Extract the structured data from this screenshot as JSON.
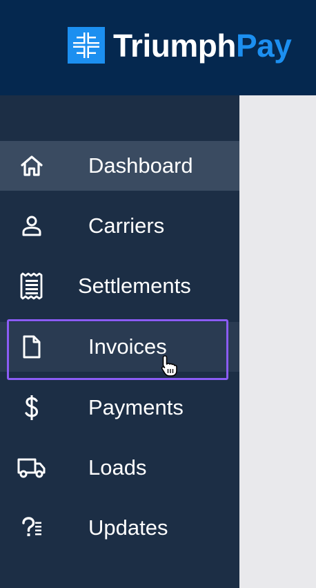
{
  "brand": {
    "name_part1": "Triumph",
    "name_part2": "Pay",
    "accent_color": "#1c8ff0",
    "header_color": "#05284f"
  },
  "sidebar": {
    "background": "#1c2e45",
    "active_item": "Dashboard",
    "hovered_item": "Invoices",
    "items": [
      {
        "label": "Dashboard",
        "icon": "home-icon"
      },
      {
        "label": "Carriers",
        "icon": "user-icon"
      },
      {
        "label": "Settlements",
        "icon": "receipt-icon"
      },
      {
        "label": "Invoices",
        "icon": "document-icon"
      },
      {
        "label": "Payments",
        "icon": "dollar-icon"
      },
      {
        "label": "Loads",
        "icon": "truck-icon"
      },
      {
        "label": "Updates",
        "icon": "question-list-icon"
      }
    ]
  }
}
